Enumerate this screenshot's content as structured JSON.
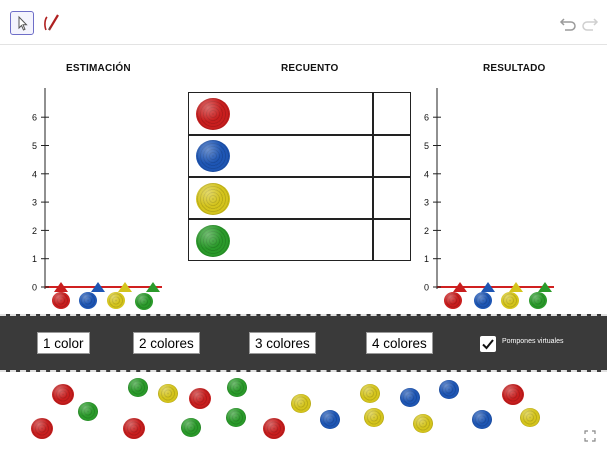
{
  "toolbar": {
    "tools": [
      "select-tool",
      "pen-tool"
    ],
    "undo_icon": "undo-icon",
    "redo_icon": "redo-icon"
  },
  "sections": {
    "estimation_title": "ESTIMACIÓN",
    "count_title": "RECUENTO",
    "result_title": "RESULTADO"
  },
  "graph": {
    "y_ticks": [
      "0",
      "1",
      "2",
      "3",
      "4",
      "5",
      "6"
    ]
  },
  "colors": {
    "red": "#c81e1e",
    "blue": "#1e56b4",
    "yellow": "#d4c41c",
    "green": "#2a9a2a",
    "control_bar": "#3a3a3a"
  },
  "tally_rows": [
    "red",
    "blue",
    "yellow",
    "green"
  ],
  "controls": {
    "buttons": [
      "1 color",
      "2 colores",
      "3 colores",
      "4 colores"
    ],
    "virtual_checkbox_label": "Pompones virtuales",
    "virtual_checked": true
  },
  "fullscreen_icon": "fullscreen-icon"
}
